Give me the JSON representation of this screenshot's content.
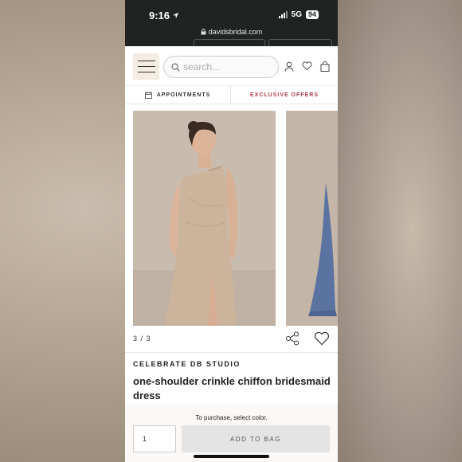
{
  "status": {
    "time": "9:16",
    "network": "5G",
    "battery": "94"
  },
  "browser": {
    "url": "davidsbridal.com"
  },
  "header": {
    "search_placeholder": "search..."
  },
  "bar": {
    "appointments": "APPOINTMENTS",
    "offers": "EXCLUSIVE OFFERS"
  },
  "gallery": {
    "pager": "3 / 3"
  },
  "product": {
    "brand": "CELEBRATE DB STUDIO",
    "title": "one-shoulder crinkle chiffon bridesmaid dress"
  },
  "purchase": {
    "notice": "To purchase, select color.",
    "quantity": "1",
    "add_label": "ADD TO BAG"
  },
  "colors": {
    "accent": "#b33a4a",
    "menu_bg": "#f5ede3",
    "dress": "#cbb39c",
    "blue_dress": "#5a73a0"
  }
}
